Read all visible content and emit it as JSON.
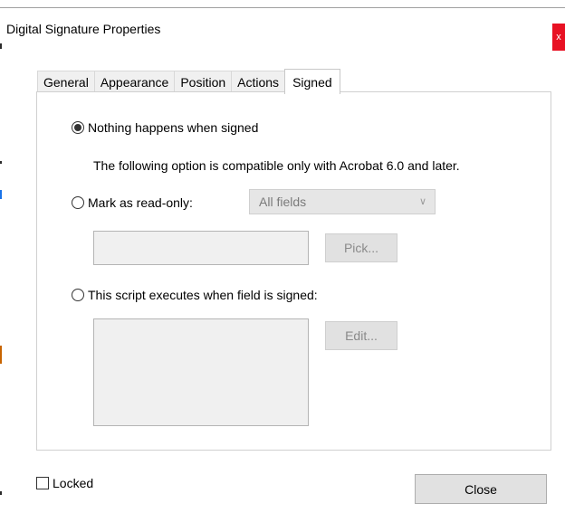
{
  "window": {
    "title": "Digital Signature Properties",
    "close_glyph": "x"
  },
  "tabs": [
    {
      "label": "General"
    },
    {
      "label": "Appearance"
    },
    {
      "label": "Position"
    },
    {
      "label": "Actions"
    },
    {
      "label": "Signed"
    }
  ],
  "signed": {
    "option_nothing": "Nothing happens when signed",
    "compat_note": "The following option is compatible only with Acrobat 6.0 and later.",
    "option_readonly": "Mark as read-only:",
    "fields_select_value": "All fields",
    "pick_button": "Pick...",
    "option_script": "This script executes when field is signed:",
    "edit_button": "Edit..."
  },
  "footer": {
    "locked_label": "Locked",
    "close_button": "Close"
  }
}
